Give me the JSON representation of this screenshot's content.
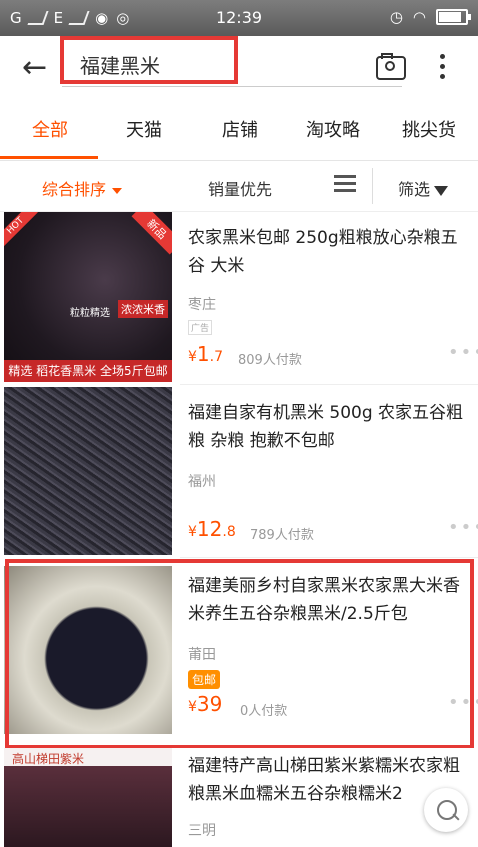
{
  "status_bar": {
    "carrier": "G",
    "network": "E",
    "time": "12:39"
  },
  "search": {
    "query": "福建黑米"
  },
  "tabs": [
    {
      "label": "全部",
      "active": true
    },
    {
      "label": "天猫"
    },
    {
      "label": "店铺"
    },
    {
      "label": "淘攻略"
    },
    {
      "label": "挑尖货"
    }
  ],
  "sort": {
    "comprehensive": "综合排序",
    "sales": "销量优先",
    "filter": "筛选"
  },
  "items": [
    {
      "title": "农家黑米包邮 250g粗粮放心杂粮五谷 大米",
      "location": "枣庄",
      "ad_tag": "广告",
      "price_symbol": "¥",
      "price_int": "1",
      "price_dec": ".7",
      "sold": "809人付款",
      "image_banner": "精选 稻花香黑米 全场5斤包邮",
      "image_hot": "HOT",
      "image_new": "新品",
      "image_text_a": "粒粒精选",
      "image_text_b": "浓浓米香"
    },
    {
      "title": "福建自家有机黑米 500g 农家五谷粗粮 杂粮 抱歉不包邮",
      "location": "福州",
      "price_symbol": "¥",
      "price_int": "12",
      "price_dec": ".8",
      "sold": "789人付款"
    },
    {
      "title": "福建美丽乡村自家黑米农家黑大米香米养生五谷杂粮黑米/2.5斤包",
      "location": "莆田",
      "tag": "包邮",
      "price_symbol": "¥",
      "price_int": "39",
      "price_dec": "",
      "sold": "0人付款"
    },
    {
      "title": "福建特产高山梯田紫米紫糯米农家粗粮黑米血糯米五谷杂粮糯米2",
      "location": "三明",
      "image_label": "高山梯田紫米"
    }
  ]
}
